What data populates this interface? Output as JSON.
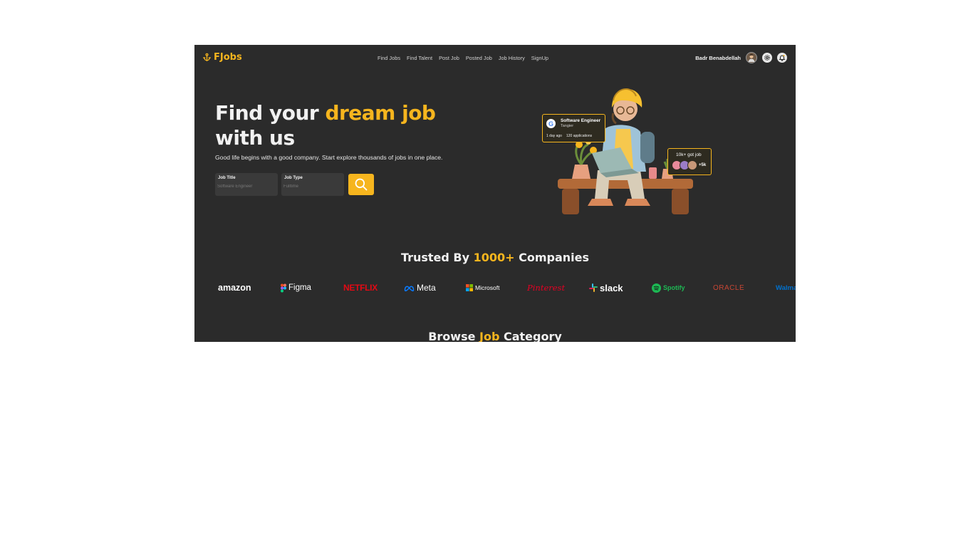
{
  "brand": {
    "name": "FJobs",
    "color": "#f6b51e"
  },
  "nav": {
    "items": [
      {
        "label": "Find Jobs"
      },
      {
        "label": "Find Talent"
      },
      {
        "label": "Post Job"
      },
      {
        "label": "Posted Job"
      },
      {
        "label": "Job History"
      },
      {
        "label": "SignUp"
      }
    ]
  },
  "user": {
    "name": "Badr Benabdellah",
    "icons": [
      "avatar",
      "gear-icon",
      "notification-bell-icon"
    ]
  },
  "hero": {
    "title_part1": "Find your ",
    "title_highlight": "dream job",
    "title_part2": " with us",
    "subtitle": "Good life begins with a good company. Start explore thousands of jobs in one place.",
    "job_title_label": "Job Title",
    "job_title_placeholder": "Software Engineer",
    "job_type_label": "Job Type",
    "job_type_placeholder": "Fulltime"
  },
  "job_card": {
    "company_icon": "google-logo",
    "title": "Software Engineer",
    "location": "Tangier",
    "posted": "1 day ago",
    "applications": "120 applications"
  },
  "stat_card": {
    "title": "10k+ got job",
    "more": "+5k"
  },
  "trusted": {
    "prefix": "Trusted By ",
    "highlight": "1000+",
    "suffix": " Companies"
  },
  "companies": [
    {
      "name": "amazon",
      "color": "#ffffff"
    },
    {
      "name": "Figma",
      "color": "#ffffff"
    },
    {
      "name": "NETFLIX",
      "color": "#e50914"
    },
    {
      "name": "Meta",
      "color": "#ffffff"
    },
    {
      "name": "Microsoft",
      "color": "#ffffff"
    },
    {
      "name": "Pinterest",
      "color": "#e60023"
    },
    {
      "name": "slack",
      "color": "#ffffff"
    },
    {
      "name": "Spotify",
      "color": "#1db954"
    },
    {
      "name": "ORACLE",
      "color": "#c74634"
    },
    {
      "name": "Walmart",
      "color": "#0071ce"
    }
  ],
  "browse": {
    "prefix": "Browse ",
    "highlight": "Job",
    "suffix": " Category"
  }
}
